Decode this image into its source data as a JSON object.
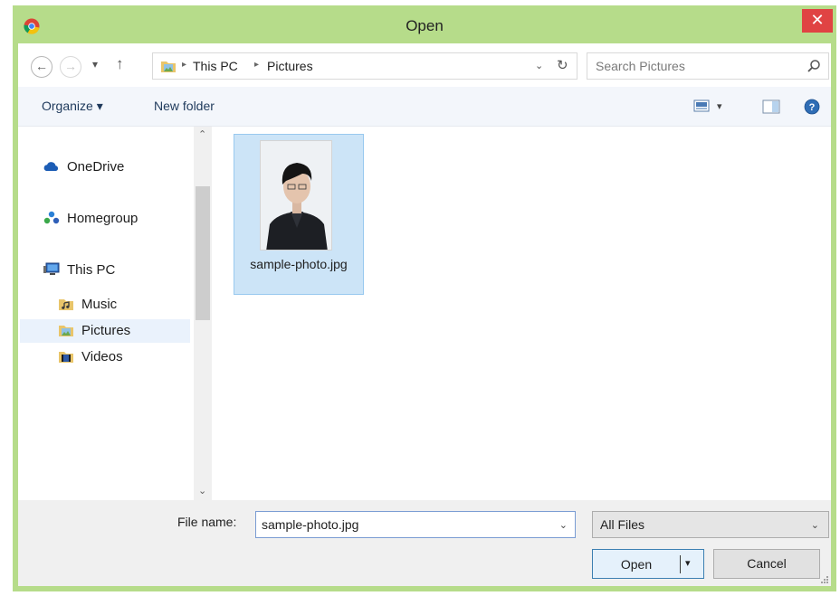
{
  "window": {
    "title": "Open",
    "close_glyph": "✕"
  },
  "nav": {
    "back_glyph": "←",
    "forward_glyph": "→",
    "recent_glyph": "▾",
    "up_glyph": "↑",
    "breadcrumb": [
      "This PC",
      "Pictures"
    ],
    "separator_glyph": "▸",
    "address_dropdown_glyph": "⌄",
    "refresh_glyph": "↻",
    "search_placeholder": "Search Pictures"
  },
  "toolbar": {
    "organize_label": "Organize ▾",
    "new_folder_label": "New folder",
    "view_dropdown_glyph": "▾"
  },
  "sidebar": {
    "items": [
      {
        "label": "OneDrive",
        "icon": "cloud-icon"
      },
      {
        "label": "Homegroup",
        "icon": "homegroup-icon"
      },
      {
        "label": "This PC",
        "icon": "computer-icon"
      },
      {
        "label": "Music",
        "icon": "music-folder-icon"
      },
      {
        "label": "Pictures",
        "icon": "pictures-folder-icon",
        "selected": true
      },
      {
        "label": "Videos",
        "icon": "videos-folder-icon"
      }
    ],
    "scroll_up_glyph": "⌃",
    "scroll_down_glyph": "⌄"
  },
  "files": [
    {
      "name": "sample-photo.jpg",
      "selected": true
    }
  ],
  "footer": {
    "filename_label": "File name:",
    "filename_value": "sample-photo.jpg",
    "filename_dropdown_glyph": "⌄",
    "filter_value": "All Files",
    "filter_dropdown_glyph": "⌄",
    "open_label": "Open",
    "open_dropdown_glyph": "▾",
    "cancel_label": "Cancel"
  },
  "colors": {
    "frame": "#b6dc8a",
    "close": "#e04343",
    "selection": "#cce4f7",
    "selection_border": "#99c9ef",
    "toolbar_text": "#1e395b"
  }
}
